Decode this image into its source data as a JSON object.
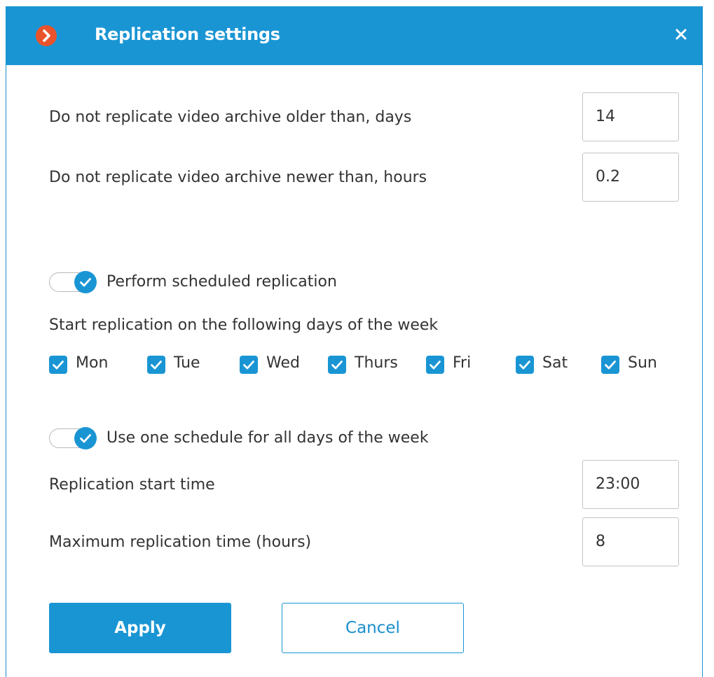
{
  "dialog": {
    "title": "Replication settings",
    "accent_color": "#1a95d4",
    "logo_color": "#e9532b",
    "logo_icon": "chevron-right-icon",
    "close_icon": "close-icon"
  },
  "archive": {
    "older_label": "Do not replicate video archive older than, days",
    "older_value": "14",
    "newer_label": "Do not replicate video archive newer than, hours",
    "newer_value": "0.2"
  },
  "schedule": {
    "toggle_label": "Perform scheduled replication",
    "toggle_on": true,
    "days_label": "Start replication on the following days of the week",
    "days": [
      {
        "label": "Mon",
        "checked": true
      },
      {
        "label": "Tue",
        "checked": true
      },
      {
        "label": "Wed",
        "checked": true
      },
      {
        "label": "Thurs",
        "checked": true
      },
      {
        "label": "Fri",
        "checked": true
      },
      {
        "label": "Sat",
        "checked": true
      },
      {
        "label": "Sun",
        "checked": true
      }
    ],
    "one_schedule_label": "Use one schedule for all days of the week",
    "one_schedule_on": true,
    "start_time_label": "Replication start time",
    "start_time_value": "23:00",
    "max_time_label": "Maximum replication time (hours)",
    "max_time_value": "8"
  },
  "buttons": {
    "apply": "Apply",
    "cancel": "Cancel"
  }
}
